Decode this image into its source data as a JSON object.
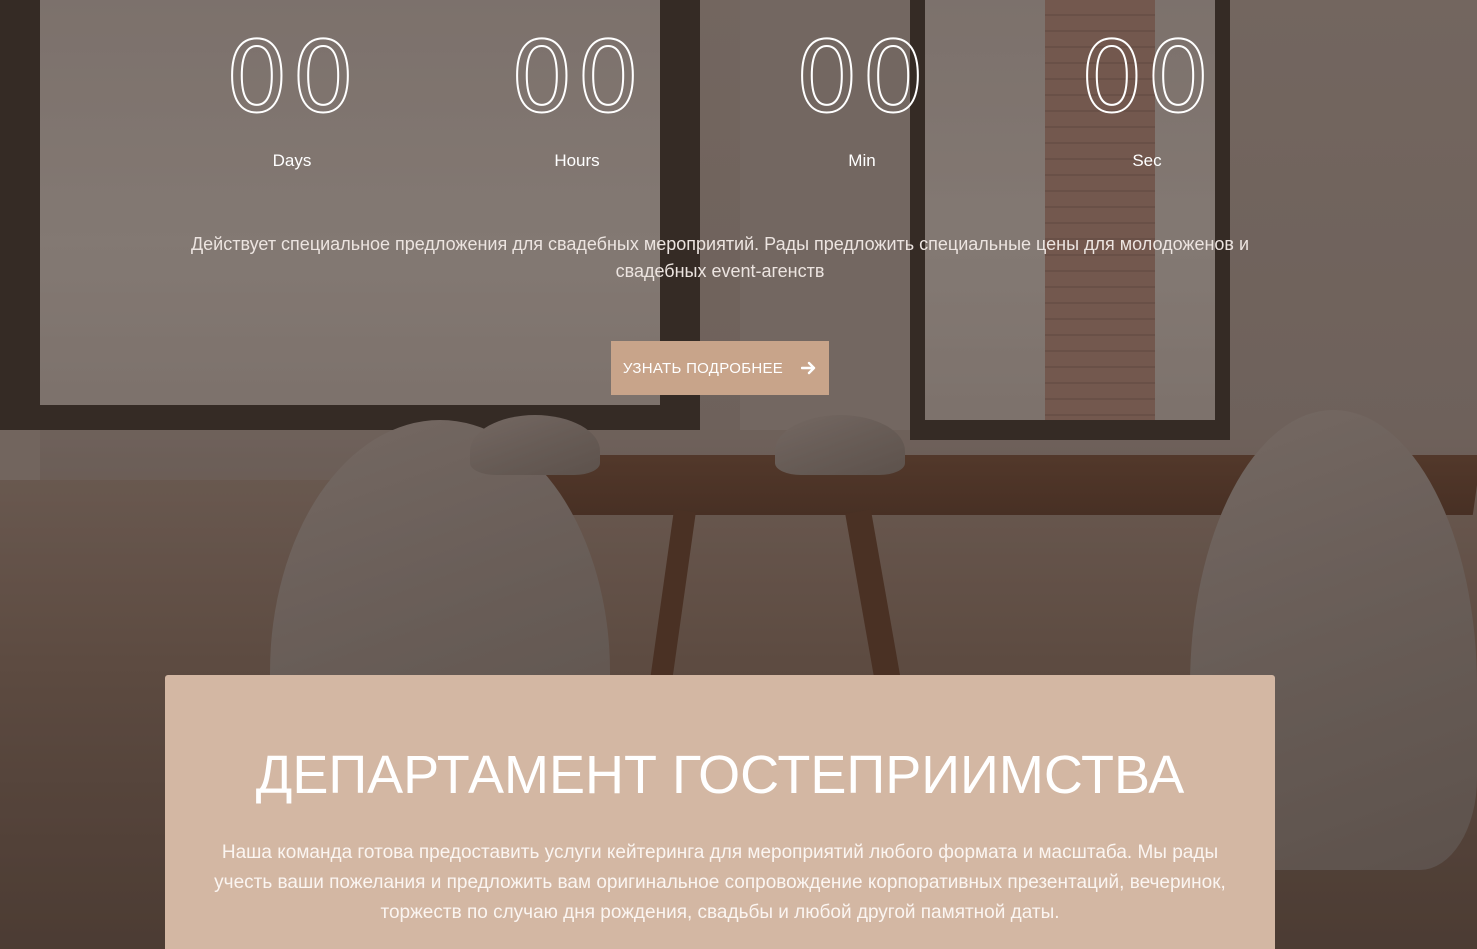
{
  "countdown": {
    "units": [
      {
        "value": "00",
        "label": "Days"
      },
      {
        "value": "00",
        "label": "Hours"
      },
      {
        "value": "00",
        "label": "Min"
      },
      {
        "value": "00",
        "label": "Sec"
      }
    ]
  },
  "promo": {
    "text": "Действует специальное предложения для свадебных мероприятий. Рады предложить специальные цены для молодоженов и свадебных event-агенств"
  },
  "cta": {
    "label": "УЗНАТЬ ПОДРОБНЕЕ",
    "icon": "arrow-right-icon"
  },
  "hospitality": {
    "title": "ДЕПАРТАМЕНТ ГОСТЕПРИИМСТВА",
    "text": "Наша команда готова предоставить услуги кейтеринга для мероприятий любого формата и масштаба. Мы рады учесть ваши пожелания и предложить вам оригинальное сопровождение корпоративных презентаций, вечеринок, торжеств по случаю дня рождения, свадьбы и любой другой памятной даты."
  },
  "colors": {
    "accent_button": "#c8a48a",
    "card_background": "#d3b7a3",
    "text_light": "#ffffff"
  }
}
